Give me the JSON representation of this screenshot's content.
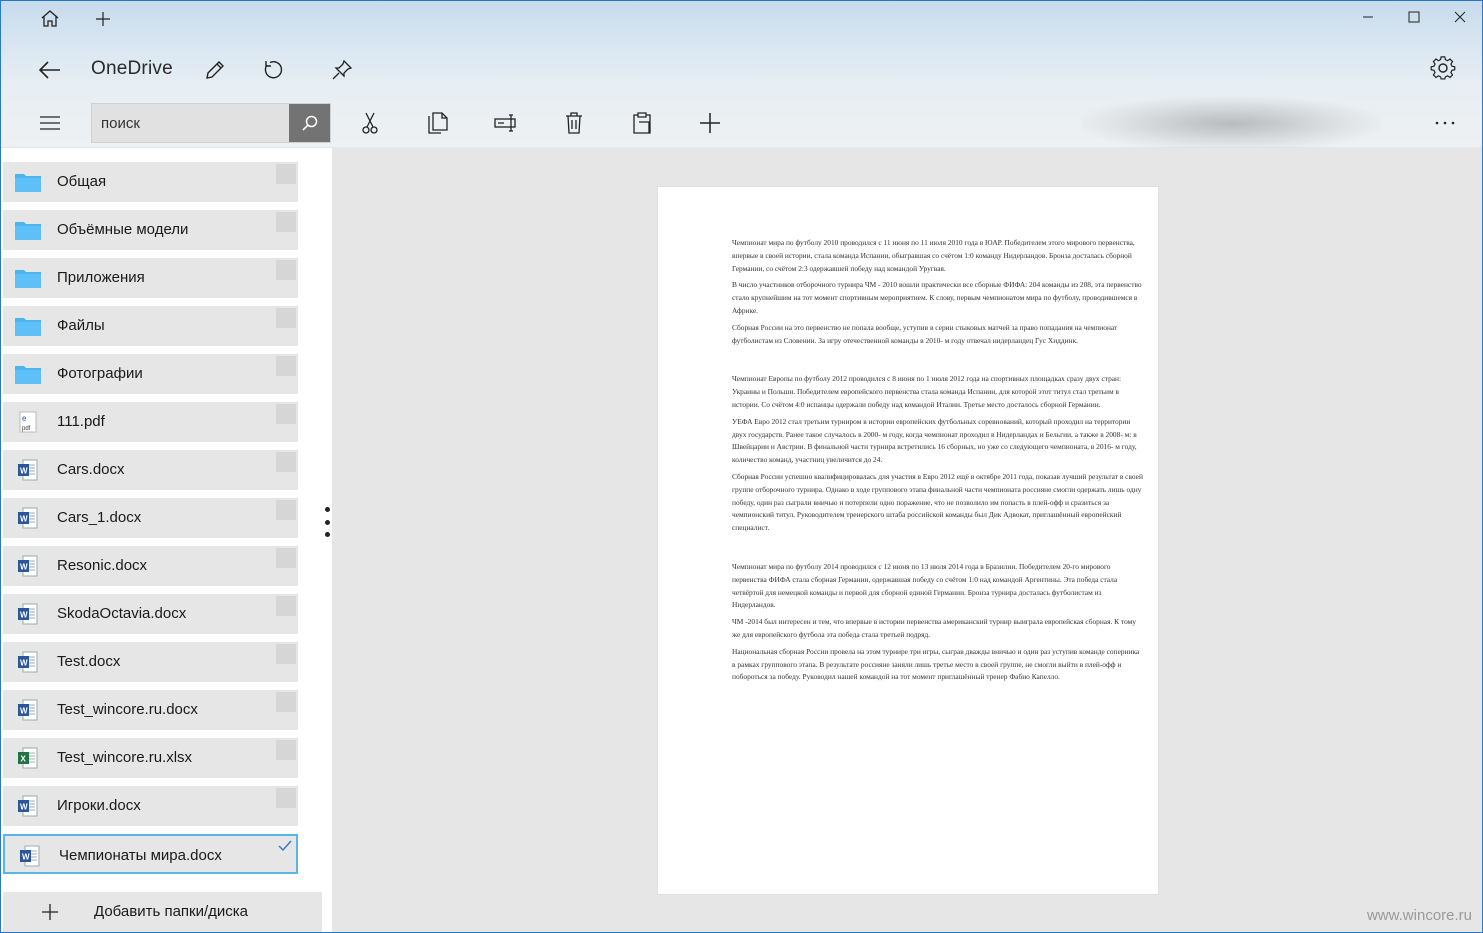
{
  "app": {
    "title": "OneDrive"
  },
  "window_controls": [
    "minimize-icon",
    "maximize-icon",
    "close-icon"
  ],
  "search": {
    "placeholder": "поиск",
    "value": ""
  },
  "files": [
    {
      "name": "Общая",
      "type": "folder",
      "selected": false
    },
    {
      "name": "Объёмные модели",
      "type": "folder",
      "selected": false
    },
    {
      "name": "Приложения",
      "type": "folder",
      "selected": false
    },
    {
      "name": "Файлы",
      "type": "folder",
      "selected": false
    },
    {
      "name": "Фотографии",
      "type": "folder",
      "selected": false
    },
    {
      "name": "111.pdf",
      "type": "pdf",
      "selected": false
    },
    {
      "name": "Cars.docx",
      "type": "docx",
      "selected": false
    },
    {
      "name": "Cars_1.docx",
      "type": "docx",
      "selected": false
    },
    {
      "name": "Resonic.docx",
      "type": "docx",
      "selected": false
    },
    {
      "name": "SkodaOctavia.docx",
      "type": "docx",
      "selected": false
    },
    {
      "name": "Test.docx",
      "type": "docx",
      "selected": false
    },
    {
      "name": "Test_wincore.ru.docx",
      "type": "docx",
      "selected": false
    },
    {
      "name": "Test_wincore.ru.xlsx",
      "type": "xlsx",
      "selected": false
    },
    {
      "name": "Игроки.docx",
      "type": "docx",
      "selected": false
    },
    {
      "name": "Чемпионаты мира.docx",
      "type": "docx",
      "selected": true
    }
  ],
  "add_folder": {
    "label": "Добавить папки/диска"
  },
  "document": {
    "paragraphs": [
      "Чемпионат мира по футболу 2010 проводился с 11 июня по 11 июля 2010 года в ЮАР. Победителем этого мирового первенства, впервые в своей истории, стала команда Испании, обыгравшая со счётом 1:0 команду Нидерландов. Бронза досталась сборной Германии, со счётом 2:3 одержавшей победу над командой Уругвая.",
      "В число участников отборочного турнира ЧМ - 2010 вошли практически все сборные ФИФА: 204 команды из 208, эта первенство стало крупнейшим на тот момент спортивным мероприятием. К слову, первым чемпионатом мира по футболу, проводившемся в Африке.",
      "Сборная России на это первенство не попала вообще, уступив в серии стыковых матчей за право попадания на чемпионат футболистам из Словении. За игру отечественной команды в 2010- м году отвечал нидерландец Гус Хиддинк.",
      "",
      "Чемпионат Европы по футболу 2012 проводился с 8 июня по 1 июля 2012 года на спортивных площадках сразу двух стран: Украины и Польши. Победителем европейского первенства стала команда Испании, для которой этот титул стал третьим в истории. Со счётом 4:0 испанцы одержали победу над командой Италии. Третье место досталось сборной Германии.",
      "УЕФА Евро 2012 стал третьим турниром в истории европейских футбольных соревнований, который проходил на территории двух государств. Ранее такое случалось в 2000- м году, когда чемпионат проходил в Нидерландах и Бельгии, а также в 2008- м: в Швейцарии и Австрии. В финальной части турнира встретились 16 сборных, но уже со следующего чемпионата, в 2016- м году, количество команд, участниц увеличится до 24.",
      "Сборная России успешно квалифицировалась для участия в Евро 2012 ещё в октябре 2011 года, показав лучший результат в своей группе отборочного турнира. Однако в ходе группового этапа финальной части чемпионата россияне смогли одержать лишь одну победу, один раз сыграли вничью и потерпели одно поражение, что не позволило им попасть в плей-офф и сразиться за чемпионский титул. Руководителем тренерского штаба российской команды был Дик Адвокат, приглашённый европейский специалист.",
      "",
      "Чемпионат мира по футболу 2014 проводился с 12 июня по 13 июля 2014 года в Бразилии. Победителем 20-го мирового первенства ФИФА стала сборная Германии, одержавшая победу со счётом 1:0 над командой Аргентины. Эта победа стала четвёртой для немецкой команды и первой для сборной единой Германии. Бронза турнира досталась футболистам из Нидерландов.",
      "ЧМ -2014 был интересен и тем, что впервые в истории первенства американский турнир выиграла европейская сборная. К тому же для европейского футбола эта победа стала третьей подряд.",
      "Национальная сборная России провела на этом турнире три игры, сыграв дважды вничью и один раз уступив команде соперника в рамках группового этапа. В результате россияне заняли лишь третье место в своей группе, не смогли выйти в плей-офф и побороться за победу. Руководил нашей командой на тот момент приглашённый тренер Фабио Капелло."
    ]
  },
  "watermark": "www.wincore.ru"
}
